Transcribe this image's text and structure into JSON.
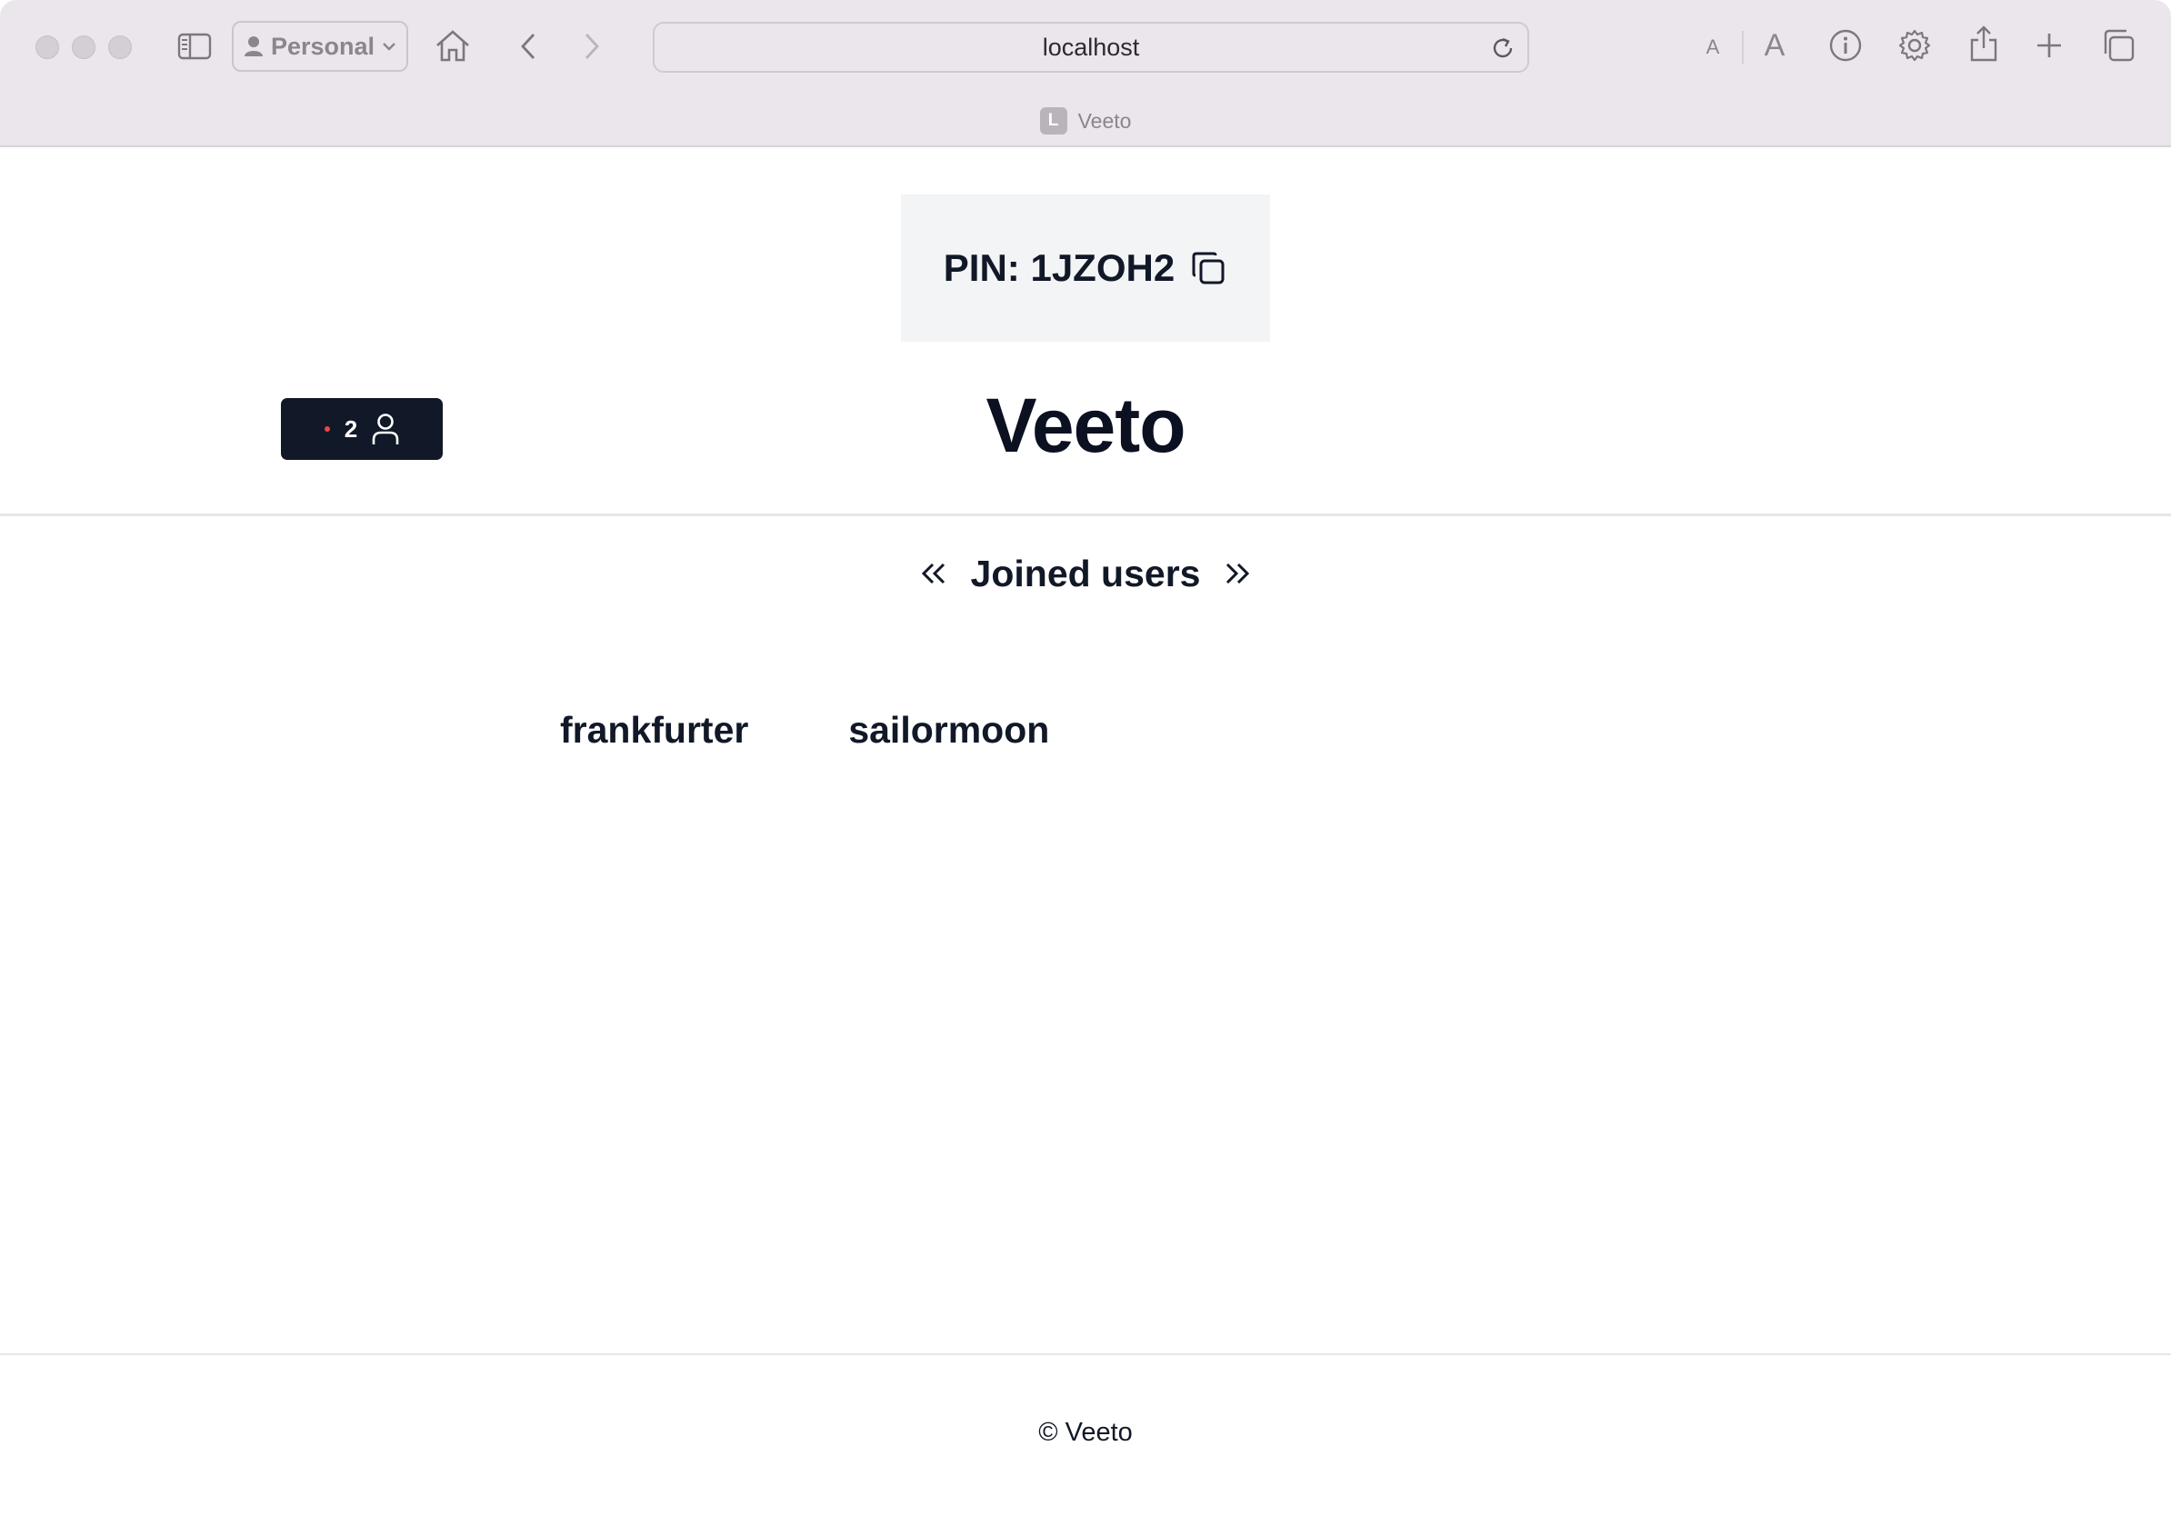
{
  "browser": {
    "profile_label": "Personal",
    "url": "localhost",
    "tab_favicon_letter": "L",
    "tab_title": "Veeto",
    "small_text_label": "A",
    "large_text_label": "A"
  },
  "page": {
    "pin_label": "PIN: 1JZOH2",
    "online_count": "2",
    "brand_title": "Veeto",
    "section_title": "Joined users",
    "users": [
      "frankfurter",
      "sailormoon"
    ],
    "footer_text": "© Veeto"
  },
  "colors": {
    "toolbar_bg": "#ebe6ec",
    "dark_badge": "#111827",
    "live_dot": "#ef4444",
    "pin_box_bg": "#f3f4f6"
  },
  "icons": [
    "sidebar-icon",
    "person-icon",
    "chevron-down-icon",
    "home-icon",
    "back-icon",
    "forward-icon",
    "reload-icon",
    "info-icon",
    "gear-icon",
    "share-icon",
    "plus-icon",
    "tabs-overview-icon",
    "copy-icon",
    "user-icon",
    "chevrons-left-icon",
    "chevrons-right-icon"
  ]
}
